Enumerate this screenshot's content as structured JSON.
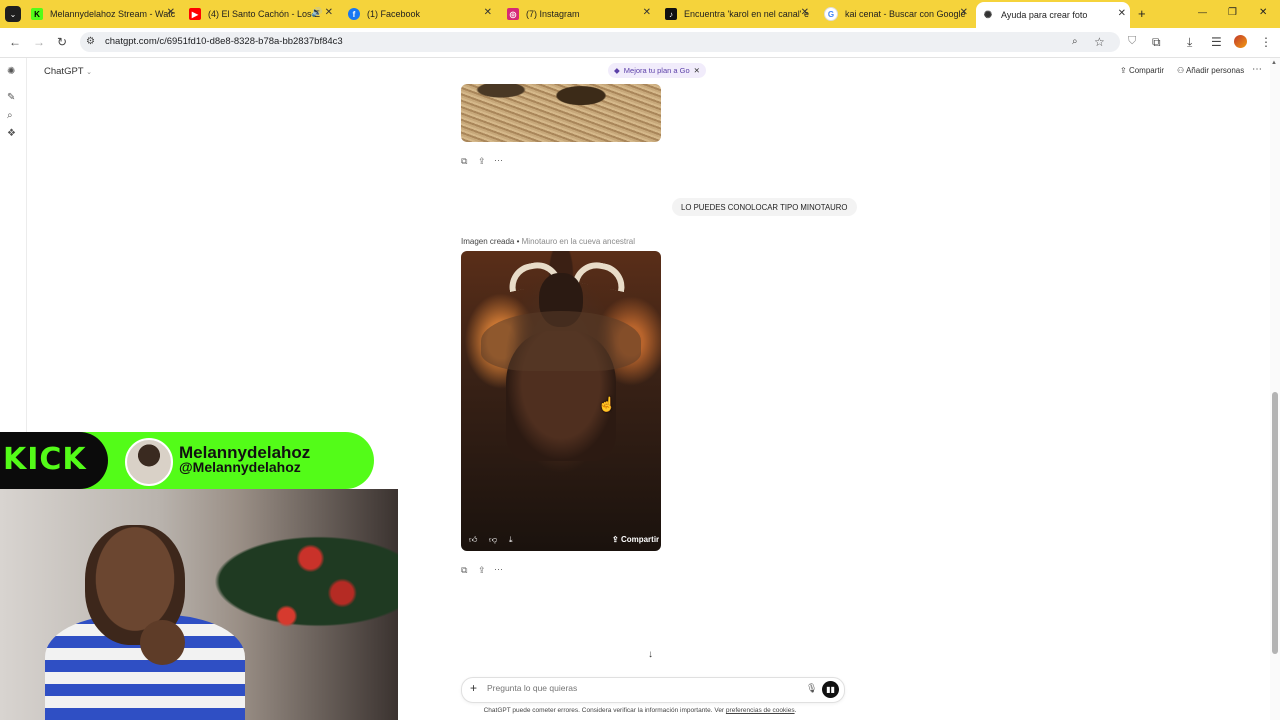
{
  "browser": {
    "tabs": [
      {
        "title": "Melannydelahoz Stream - Watc",
        "fav_color": "#53fc18",
        "fav_glyph": "K"
      },
      {
        "title": "(4) El Santo Cachón - Los E",
        "fav_color": "#ff0000",
        "fav_glyph": "▶"
      },
      {
        "title": "(1) Facebook",
        "fav_color": "#1877f2",
        "fav_glyph": "f"
      },
      {
        "title": "(7) Instagram",
        "fav_color": "#d62976",
        "fav_glyph": "◎"
      },
      {
        "title": "Encuentra 'karol en nel canal' e",
        "fav_color": "#111111",
        "fav_glyph": "♪"
      },
      {
        "title": "kai cenat - Buscar con Google",
        "fav_color": "#4285f4",
        "fav_glyph": "G"
      },
      {
        "title": "Ayuda para crear foto",
        "fav_color": "#444444",
        "fav_glyph": "✺"
      }
    ],
    "new_tab": "+",
    "url": "chatgpt.com/c/6951fd10-d8e8-8328-b78a-bb2837bf84c3",
    "window_controls": {
      "minimize": "—",
      "maximize": "❐",
      "close": "✕"
    }
  },
  "chat": {
    "model_label": "ChatGPT",
    "upgrade_label": "Mejora tu plan a Go",
    "share_label": "Compartir",
    "add_people_label": "Añadir personas",
    "user_message": "LO PUEDES CONOLOCAR TIPO MINOTAURO",
    "image_caption_prefix": "Imagen creada",
    "image_caption_title": "Minotauro en la cueva ancestral",
    "image_share_label": "Compartir",
    "composer_placeholder": "Pregunta lo que quieras",
    "disclaimer_text": "ChatGPT puede cometer errores. Considera verificar la información importante. Ver",
    "disclaimer_link": "preferencias de cookies",
    "disclaimer_end": "."
  },
  "overlay": {
    "platform": "KICK",
    "display_name": "Melannydelahoz",
    "handle": "@Melannydelahoz",
    "brand_color": "#53fc18"
  }
}
